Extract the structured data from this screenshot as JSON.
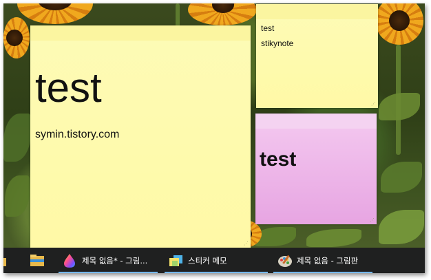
{
  "notes": {
    "large": {
      "text_big": "test",
      "text_small": "symin.tistory.com",
      "color": "#fff9a6"
    },
    "small_top": {
      "line1": "test",
      "line2": "stikynote",
      "color": "#fff9a6"
    },
    "pink": {
      "text": "test",
      "color": "#e9a9e5"
    }
  },
  "taskbar": {
    "items": [
      {
        "label": "제목 없음* - 그림...",
        "icon": "paint-3d-icon"
      },
      {
        "label": "스티커 메모",
        "icon": "sticky-notes-icon"
      },
      {
        "label": "제목 없음 - 그림판",
        "icon": "paint-icon"
      }
    ],
    "pinned": [
      "file-explorer-folder-icon",
      "file-explorer-icon"
    ],
    "accent": "#76b9ed"
  }
}
